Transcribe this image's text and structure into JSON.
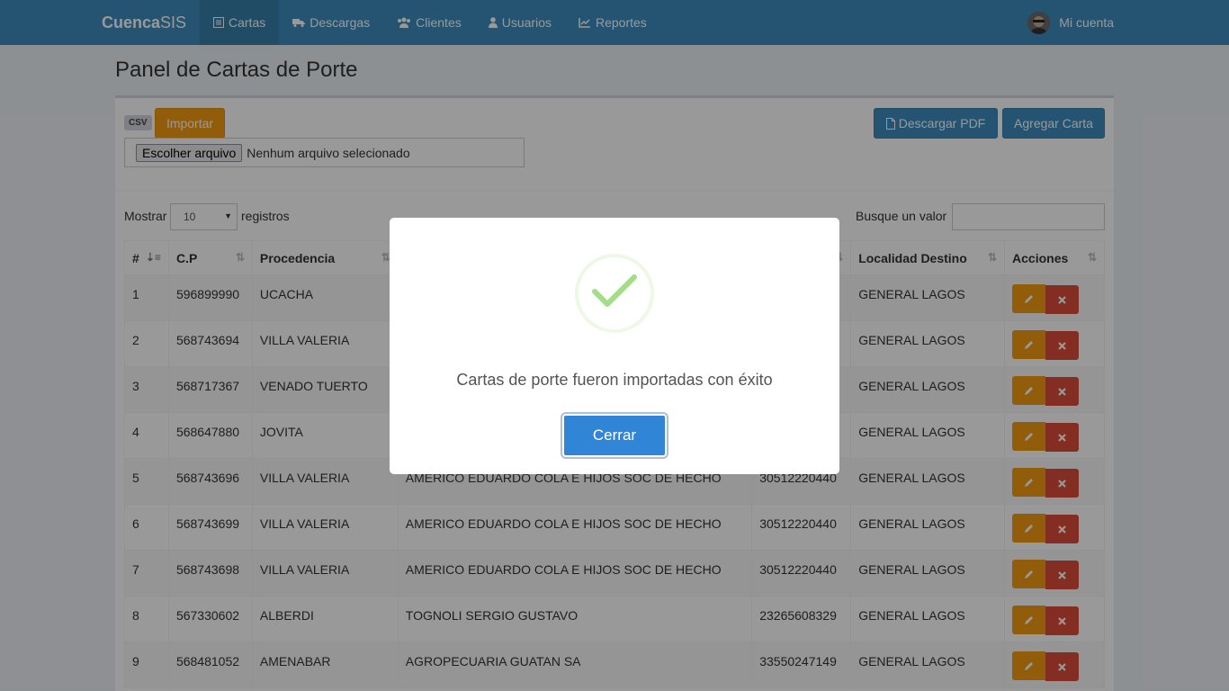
{
  "navbar": {
    "brand_bold": "Cuenca",
    "brand_rest": "SIS",
    "items": [
      {
        "label": "Cartas",
        "icon": "list-alt-icon"
      },
      {
        "label": "Descargas",
        "icon": "truck-icon"
      },
      {
        "label": "Clientes",
        "icon": "users-icon"
      },
      {
        "label": "Usuarios",
        "icon": "user-icon"
      },
      {
        "label": "Reportes",
        "icon": "line-chart-icon"
      }
    ],
    "account": "Mi cuenta"
  },
  "page": {
    "title": "Panel de Cartas de Porte"
  },
  "toolbar": {
    "csv_badge": "CSV",
    "import_label": "Importar",
    "file_button": "Escolher arquivo",
    "file_status": "Nenhum arquivo selecionado",
    "pdf_label": "Descargar PDF",
    "add_label": "Agregar Carta"
  },
  "table_controls": {
    "show_label": "Mostrar",
    "page_length": "10",
    "records_label": "registros",
    "search_label": "Busque un valor"
  },
  "table": {
    "headers": [
      "#",
      "C.P",
      "Procedencia",
      "",
      "",
      "Localidad Destino",
      "Acciones"
    ],
    "rows": [
      [
        "1",
        "596899990",
        "UCACHA",
        "",
        "",
        "GENERAL LAGOS"
      ],
      [
        "2",
        "568743694",
        "VILLA VALERIA",
        "",
        "",
        "GENERAL LAGOS"
      ],
      [
        "3",
        "568717367",
        "VENADO TUERTO",
        "",
        "",
        "GENERAL LAGOS"
      ],
      [
        "4",
        "568647880",
        "JOVITA",
        "",
        "",
        "GENERAL LAGOS"
      ],
      [
        "5",
        "568743696",
        "VILLA VALERIA",
        "AMERICO EDUARDO COLA E HIJOS SOC DE HECHO",
        "30512220440",
        "GENERAL LAGOS"
      ],
      [
        "6",
        "568743699",
        "VILLA VALERIA",
        "AMERICO EDUARDO COLA E HIJOS SOC DE HECHO",
        "30512220440",
        "GENERAL LAGOS"
      ],
      [
        "7",
        "568743698",
        "VILLA VALERIA",
        "AMERICO EDUARDO COLA E HIJOS SOC DE HECHO",
        "30512220440",
        "GENERAL LAGOS"
      ],
      [
        "8",
        "567330602",
        "ALBERDI",
        "TOGNOLI SERGIO GUSTAVO",
        "23265608329",
        "GENERAL LAGOS"
      ],
      [
        "9",
        "568481052",
        "AMENABAR",
        "AGROPECUARIA GUATAN SA",
        "33550247149",
        "GENERAL LAGOS"
      ]
    ]
  },
  "modal": {
    "message": "Cartas de porte fueron importadas con éxito",
    "close_label": "Cerrar",
    "icon": "success-check-icon"
  }
}
